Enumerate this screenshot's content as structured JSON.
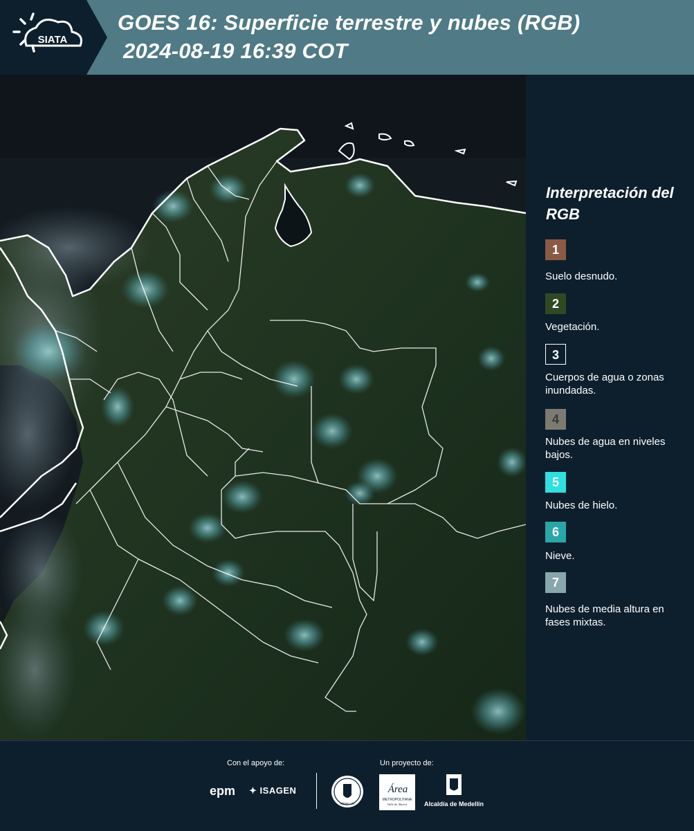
{
  "header": {
    "logo_text": "SIATA",
    "title_line1": "GOES 16: Superficie terrestre y nubes (RGB)",
    "title_line2": "2024-08-19 16:39 COT",
    "background_color": "#4f7a86"
  },
  "legend": {
    "title": "Interpretación del RGB",
    "items": [
      {
        "number": "1",
        "label": "Suelo desnudo.",
        "color": "#8a5a44"
      },
      {
        "number": "2",
        "label": "Vegetación.",
        "color": "#2f4a22"
      },
      {
        "number": "3",
        "label": "Cuerpos de agua o zonas inundadas.",
        "color": "#0d1f2d"
      },
      {
        "number": "4",
        "label": "Nubes de agua en niveles bajos.",
        "color": "#7d7a72"
      },
      {
        "number": "5",
        "label": "Nubes de hielo.",
        "color": "#2ee0e0"
      },
      {
        "number": "6",
        "label": "Nieve.",
        "color": "#2aa6a8"
      },
      {
        "number": "7",
        "label": "Nubes de media altura en fases mixtas.",
        "color": "#86a7ac"
      }
    ]
  },
  "footer": {
    "support_label": "Con el apoyo de:",
    "project_label": "Un proyecto de:",
    "sponsors": [
      "epm",
      "ISAGEN"
    ],
    "partners": {
      "area_name": "Área",
      "area_subtitle": "METROPOLITANA",
      "area_region": "Valle de Aburrá",
      "seal_text": "MEDELLÍN",
      "alcaldia": "Alcaldía de Medellín"
    }
  }
}
